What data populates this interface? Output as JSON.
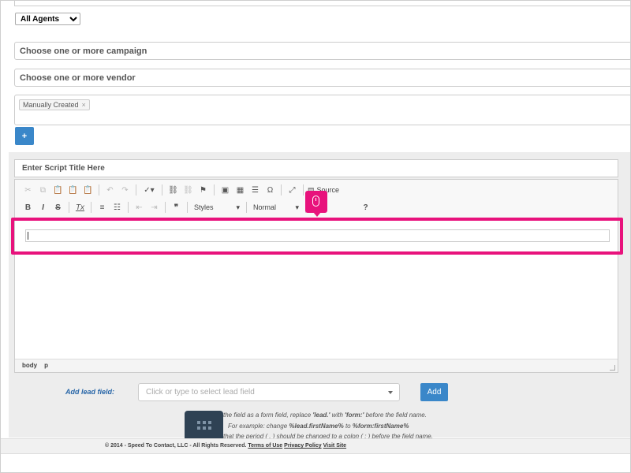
{
  "filters": {
    "agent_select": "All Agents",
    "campaign_placeholder": "Choose one or more campaign",
    "vendor_placeholder": "Choose one or more vendor",
    "tags": [
      "Manually Created"
    ],
    "tag_remove": "×",
    "add_button": "+"
  },
  "editor": {
    "title_placeholder": "Enter Script Title Here",
    "toolbar": {
      "source_label": "Source",
      "styles_label": "Styles",
      "format_label": "Normal",
      "bold": "B",
      "italic": "I",
      "strike": "S",
      "remove_format": "Tx",
      "quote": "❞",
      "omega": "Ω",
      "help": "?"
    },
    "path": [
      "body",
      "p"
    ]
  },
  "lead_field": {
    "label": "Add lead field:",
    "placeholder": "Click or type to select lead field",
    "add_label": "Add"
  },
  "hints": {
    "line1_pre": "the field as a form field, replace ",
    "line1_b1": "'lead.'",
    "line1_mid": " with ",
    "line1_b2": "'form:'",
    "line1_post": " before the field name.",
    "line2_pre": "For example: change ",
    "line2_b1": "%lead.firstName%",
    "line2_mid": " to ",
    "line2_b2": "%form:firstName%",
    "line3": "that the period ( . ) should be changed to a colon ( : ) before the field name."
  },
  "footer": {
    "copyright": "© 2014 - Speed To Contact, LLC - All Rights Reserved.",
    "terms": "Terms of Use",
    "privacy": "Privacy Policy",
    "visit": "Visit Site"
  },
  "colors": {
    "highlight": "#e8127c",
    "primary_button": "#3a87c9",
    "label_blue": "#2866a8"
  }
}
